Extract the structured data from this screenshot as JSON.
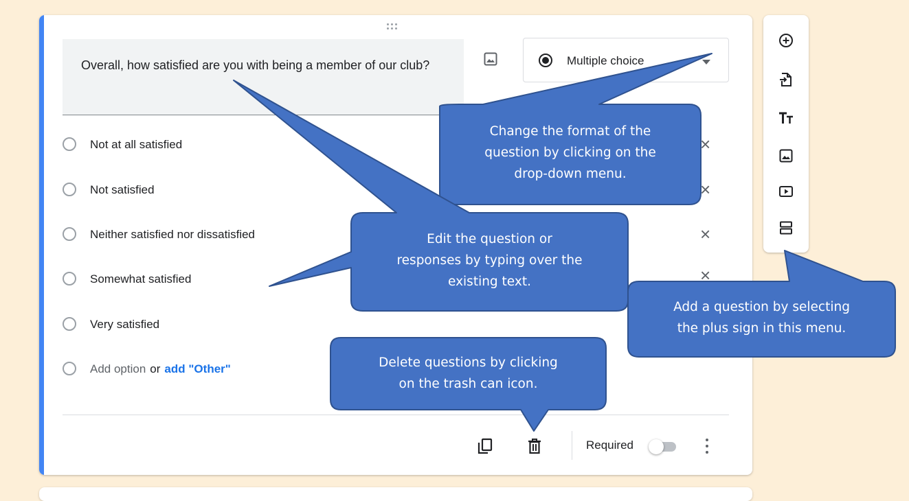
{
  "question": {
    "title": "Overall, how satisfied are you with being a member of our club?",
    "type_label": "Multiple choice"
  },
  "options": [
    {
      "label": "Not at all satisfied"
    },
    {
      "label": "Not satisfied"
    },
    {
      "label": "Neither satisfied nor dissatisfied"
    },
    {
      "label": "Somewhat satisfied"
    },
    {
      "label": "Very satisfied"
    }
  ],
  "add_option": {
    "label": "Add option",
    "or": "or",
    "other_label": "add \"Other\""
  },
  "footer": {
    "required_label": "Required",
    "required_on": false
  },
  "sidebar": {
    "icons": [
      "add-question-icon",
      "import-questions-icon",
      "add-title-icon",
      "add-image-icon",
      "add-video-icon",
      "add-section-icon"
    ]
  },
  "callouts": {
    "format": [
      "Change the format of the",
      "question by clicking on the",
      "drop-down menu."
    ],
    "edit": [
      "Edit the question or",
      "responses by typing over the",
      "existing text."
    ],
    "add": [
      "Add a question by selecting",
      "the plus sign in this menu."
    ],
    "delete": [
      "Delete questions by clicking",
      "on the trash can icon."
    ]
  },
  "colors": {
    "background": "#fdefd8",
    "accent": "#4285f4",
    "callout_fill": "#4472c4",
    "callout_border": "#2f528f",
    "link": "#1a73e8"
  }
}
